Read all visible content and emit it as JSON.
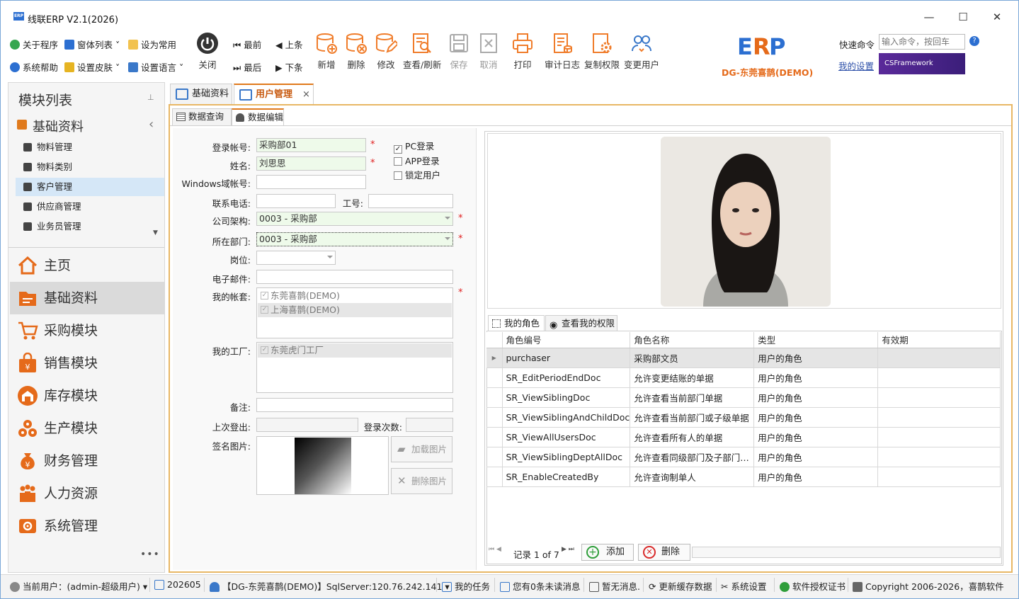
{
  "window": {
    "title": "线联ERP V2.1(2026)",
    "logo_text": "ERP"
  },
  "ribbon": {
    "small_row1": [
      "关于程序",
      "窗体列表",
      "设为常用"
    ],
    "small_row2": [
      "系统帮助",
      "设置皮肤",
      "设置语言"
    ],
    "close": "关闭",
    "nav_first": "最前",
    "nav_prev": "上条",
    "nav_last": "最后",
    "nav_next": "下条",
    "buttons": [
      "新增",
      "删除",
      "修改",
      "查看/刷新",
      "保存",
      "取消",
      "打印",
      "审计日志",
      "复制权限",
      "变更用户"
    ],
    "brand": "DG-东莞喜鹊(DEMO)",
    "quick_label": "快速命令",
    "quick_placeholder": "输入命令，按回车",
    "my_settings": "我的设置",
    "csframework": "CSFramework",
    "colors": {
      "accent": "#e07a1c",
      "brand": "#e56a1a",
      "blue": "#2c6fd1",
      "ribbon_orange": "#f07c2a"
    }
  },
  "sidebar": {
    "title": "模块列表",
    "group": "基础资料",
    "items": [
      "物料管理",
      "物料类别",
      "客户管理",
      "供应商管理",
      "业务员管理"
    ],
    "selected_item": "客户管理",
    "modules": [
      "主页",
      "基础资料",
      "采购模块",
      "销售模块",
      "库存模块",
      "生产模块",
      "财务管理",
      "人力资源",
      "系统管理"
    ],
    "selected_module": "基础资料",
    "more": "•••"
  },
  "tabs": {
    "main": [
      "基础资料",
      "用户管理"
    ],
    "active": "用户管理",
    "sub": [
      "数据查询",
      "数据编辑"
    ],
    "sub_active": "数据编辑",
    "close": "×"
  },
  "form": {
    "login_label": "登录帐号:",
    "login_value": "采购部01",
    "name_label": "姓名:",
    "name_value": "刘思思",
    "windows_label": "Windows域帐号:",
    "phone_label": "联系电话:",
    "empno_label": "工号:",
    "company_label": "公司架构:",
    "company_value": "0003 - 采购部",
    "dept_label": "所在部门:",
    "dept_value": "0003 - 采购部",
    "post_label": "岗位:",
    "email_label": "电子邮件:",
    "accounts_label": "我的帐套:",
    "accounts": [
      "东莞喜鹊(DEMO)",
      "上海喜鹊(DEMO)"
    ],
    "factory_label": "我的工厂:",
    "factories": [
      "东莞虎门工厂"
    ],
    "remark_label": "备注:",
    "lastlogout_label": "上次登出:",
    "logincount_label": "登录次数:",
    "sign_label": "签名图片:",
    "load_image": "加载图片",
    "delete_image": "删除图片",
    "pc_login": "PC登录",
    "app_login": "APP登录",
    "lock_user": "锁定用户",
    "req": "*",
    "check": "✓"
  },
  "roles": {
    "tab_my_roles": "我的角色",
    "tab_my_perms": "查看我的权限",
    "headers": [
      "角色编号",
      "角色名称",
      "类型",
      "有效期"
    ],
    "rows": [
      [
        "purchaser",
        "采购部文员",
        "用户的角色",
        ""
      ],
      [
        "SR_EditPeriodEndDoc",
        "允许变更结账的单据",
        "用户的角色",
        ""
      ],
      [
        "SR_ViewSiblingDoc",
        "允许查看当前部门单据",
        "用户的角色",
        ""
      ],
      [
        "SR_ViewSiblingAndChildDoc",
        "允许查看当前部门或子级单据",
        "用户的角色",
        ""
      ],
      [
        "SR_ViewAllUsersDoc",
        "允许查看所有人的单据",
        "用户的角色",
        ""
      ],
      [
        "SR_ViewSiblingDeptAllDoc",
        "允许查看同级部门及子部门…",
        "用户的角色",
        ""
      ],
      [
        "SR_EnableCreatedBy",
        "允许查询制单人",
        "用户的角色",
        ""
      ]
    ],
    "record_text": "记录 1 of 7",
    "add": "添加",
    "delete": "删除"
  },
  "status": {
    "user": "当前用户：(admin-超级用户)",
    "period": "202605",
    "db": "【DG-东莞喜鹊(DEMO)】SqlServer:120.76.242.141",
    "tasks": "我的任务",
    "unread": "您有0条未读消息",
    "notice": "暂无消息.",
    "refresh": "更新缓存数据",
    "settings": "系统设置",
    "license": "软件授权证书",
    "copyright": "Copyright 2006-2026，喜鹊软件"
  }
}
